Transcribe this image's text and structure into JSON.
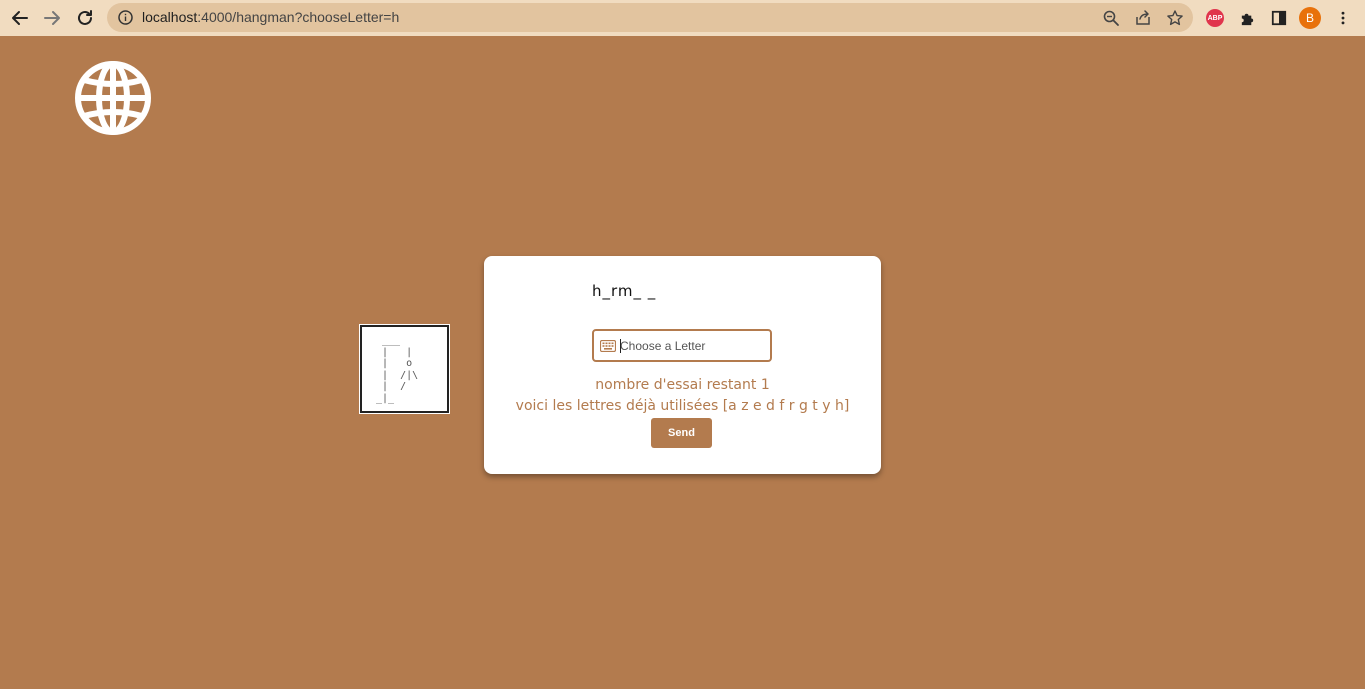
{
  "browser": {
    "url_host": "localhost",
    "url_rest": ":4000/hangman?chooseLetter=h",
    "avatar_letter": "B",
    "abp_label": "ABP"
  },
  "colors": {
    "page_background": "#b37b4e",
    "accent": "#b37b4e",
    "card": "#ffffff"
  },
  "icons": [
    "back-arrow-icon",
    "forward-arrow-icon",
    "reload-icon",
    "info-icon",
    "zoom-icon",
    "share-icon",
    "star-icon",
    "puzzle-icon",
    "side-panel-icon",
    "menu-icon",
    "globe-icon",
    "keyboard-icon"
  ],
  "game": {
    "hangman_art": " ___\n |   |\n |   o\n |  /|\\\n |  /\n_|_",
    "word_display": "h_rm_ _",
    "input_value": "",
    "input_placeholder": "Choose a Letter",
    "tries_text": "nombre d'essai restant 1",
    "used_letters_text": "voici les lettres déjà utilisées [a z e d f r g t y h]",
    "send_label": "Send"
  }
}
